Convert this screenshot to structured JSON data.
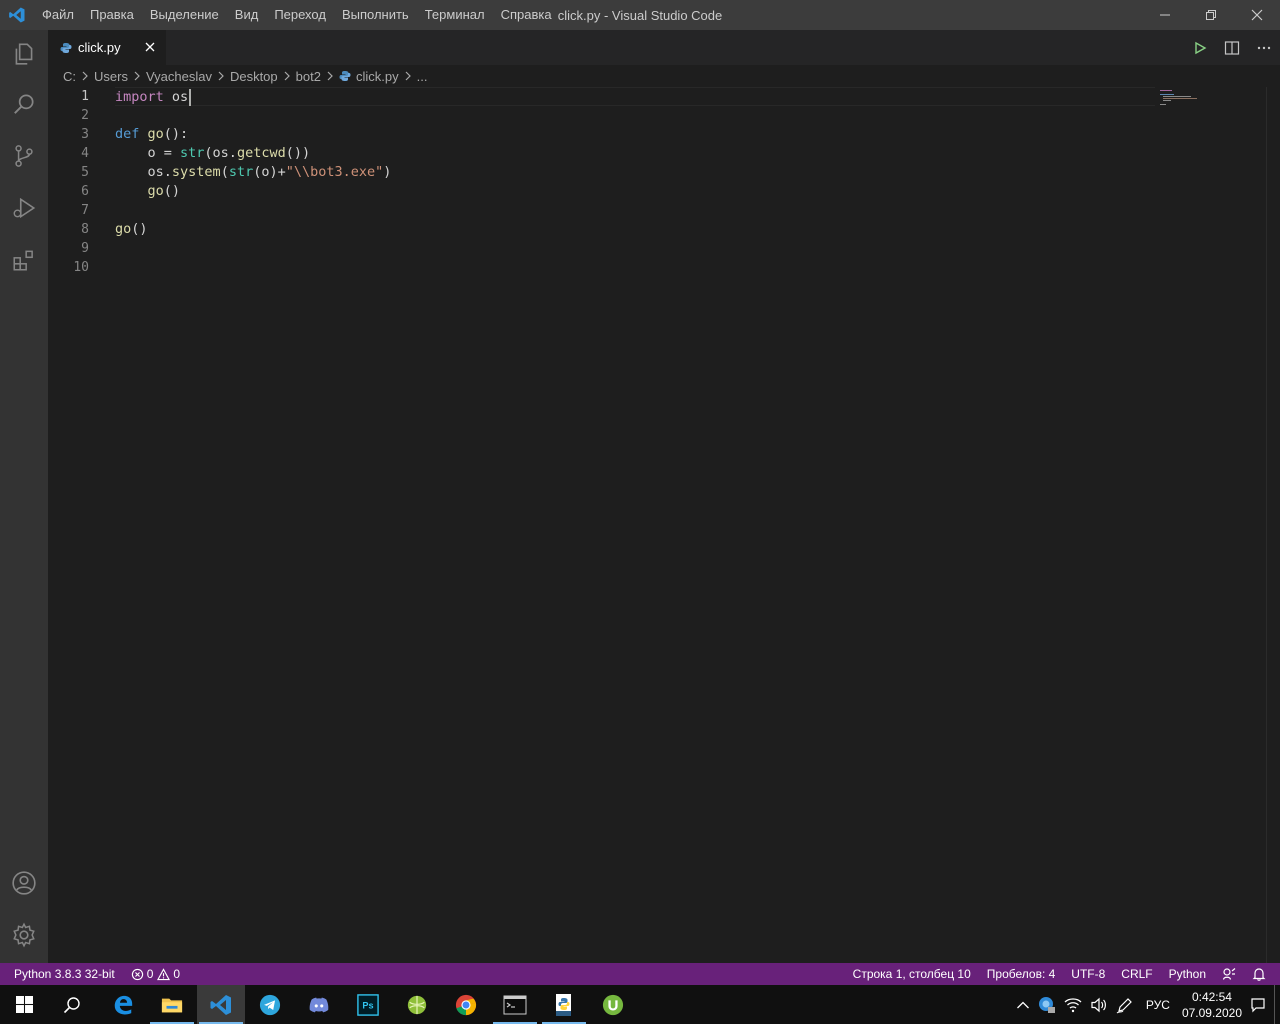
{
  "window": {
    "title": "click.py - Visual Studio Code",
    "menu": [
      "Файл",
      "Правка",
      "Выделение",
      "Вид",
      "Переход",
      "Выполнить",
      "Терминал",
      "Справка"
    ]
  },
  "tab": {
    "label": "click.py"
  },
  "breadcrumbs": [
    "C:",
    "Users",
    "Vyacheslav",
    "Desktop",
    "bot2",
    "click.py",
    "..."
  ],
  "editor": {
    "line_numbers": [
      "1",
      "2",
      "3",
      "4",
      "5",
      "6",
      "7",
      "8",
      "9",
      "10"
    ],
    "active_line": 1
  },
  "statusbar": {
    "interpreter": "Python 3.8.3 32-bit",
    "errors": "0",
    "warnings": "0",
    "position": "Строка 1, столбец 10",
    "indent": "Пробелов: 4",
    "encoding": "UTF-8",
    "eol": "CRLF",
    "language": "Python"
  },
  "taskbar": {
    "language": "РУС",
    "time": "0:42:54",
    "date": "07.09.2020"
  },
  "colors": {
    "statusbar": "#68217a",
    "titlebar": "#3c3c3c",
    "activitybar": "#333333",
    "editor": "#1e1e1e"
  }
}
